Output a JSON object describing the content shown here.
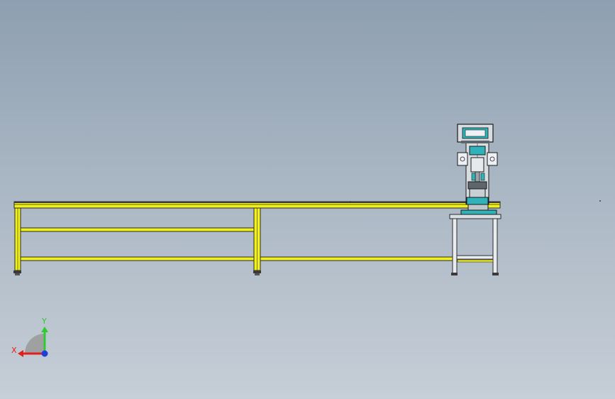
{
  "app": {
    "view": "front",
    "background_top": "#8e9fb1",
    "background_bottom": "#c6ced7"
  },
  "model": {
    "rail_color": "#f2f21a",
    "frame_color": "#2b2b2b",
    "machine_accent": "#2fb3b8"
  },
  "triad": {
    "x_label": "X",
    "y_label": "Y",
    "x_color": "#e0201c",
    "y_color": "#2ecc2e",
    "z_color": "#1f3fd8"
  }
}
